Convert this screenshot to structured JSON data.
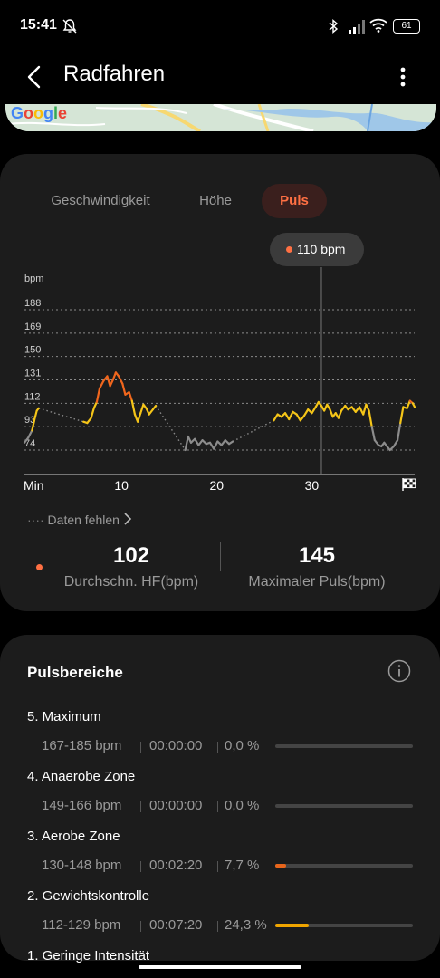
{
  "status_bar": {
    "time": "15:41",
    "battery": "61"
  },
  "header": {
    "title": "Radfahren"
  },
  "map": {
    "logo": "Google"
  },
  "tabs": [
    {
      "label": "Geschwindigkeit",
      "active": false
    },
    {
      "label": "Höhe",
      "active": false
    },
    {
      "label": "Puls",
      "active": true
    }
  ],
  "tooltip": {
    "text": "110 bpm"
  },
  "chart_data": {
    "type": "line",
    "ylabel": "bpm",
    "y_ticks": [
      188,
      169,
      150,
      131,
      112,
      93,
      74
    ],
    "x_ticks": [
      "Min",
      "10",
      "20",
      "30"
    ],
    "xlim": [
      0,
      41
    ],
    "selected_x": 31.2,
    "series": [
      {
        "segments": [
          [
            [
              0,
              80
            ],
            [
              0.4,
              84
            ],
            [
              0.8,
              90
            ],
            [
              1.1,
              100
            ],
            [
              1.3,
              106
            ],
            [
              1.5,
              108
            ]
          ],
          [
            [
              6.2,
              97
            ],
            [
              6.6,
              96
            ],
            [
              7.0,
              100
            ],
            [
              7.3,
              108
            ],
            [
              7.6,
              113
            ],
            [
              7.9,
              124
            ],
            [
              8.3,
              130
            ],
            [
              8.7,
              134
            ],
            [
              9.0,
              126
            ],
            [
              9.3,
              131
            ],
            [
              9.6,
              137
            ],
            [
              9.9,
              134
            ],
            [
              10.3,
              128
            ],
            [
              10.6,
              119
            ],
            [
              11.0,
              121
            ],
            [
              11.3,
              114
            ],
            [
              11.6,
              103
            ],
            [
              11.9,
              97
            ],
            [
              12.2,
              104
            ],
            [
              12.5,
              111
            ],
            [
              12.8,
              108
            ],
            [
              13.1,
              103
            ],
            [
              13.5,
              107
            ],
            [
              13.8,
              110
            ]
          ],
          [
            [
              16.9,
              74
            ],
            [
              17.2,
              85
            ],
            [
              17.5,
              80
            ],
            [
              17.9,
              83
            ],
            [
              18.3,
              78
            ],
            [
              18.7,
              82
            ],
            [
              19.1,
              79
            ],
            [
              19.5,
              80
            ],
            [
              19.9,
              75
            ],
            [
              20.3,
              81
            ],
            [
              20.7,
              78
            ],
            [
              21.1,
              82
            ],
            [
              21.5,
              79
            ],
            [
              21.9,
              81
            ]
          ],
          [
            [
              26.2,
              98
            ],
            [
              26.6,
              103
            ],
            [
              27.0,
              101
            ],
            [
              27.4,
              104
            ],
            [
              27.8,
              99
            ],
            [
              28.2,
              105
            ],
            [
              28.6,
              103
            ],
            [
              29.0,
              98
            ],
            [
              29.4,
              102
            ],
            [
              29.8,
              107
            ],
            [
              30.2,
              104
            ],
            [
              30.6,
              109
            ],
            [
              30.9,
              113
            ],
            [
              31.2,
              110
            ],
            [
              31.5,
              106
            ],
            [
              31.8,
              111
            ],
            [
              32.1,
              107
            ],
            [
              32.4,
              101
            ],
            [
              32.7,
              104
            ],
            [
              33.0,
              100
            ],
            [
              33.3,
              106
            ],
            [
              33.7,
              110
            ],
            [
              34.0,
              107
            ],
            [
              34.4,
              109
            ],
            [
              34.8,
              105
            ],
            [
              35.2,
              109
            ],
            [
              35.6,
              103
            ],
            [
              35.9,
              111
            ],
            [
              36.2,
              106
            ],
            [
              36.5,
              93
            ],
            [
              36.8,
              82
            ],
            [
              37.2,
              78
            ],
            [
              37.5,
              77
            ],
            [
              37.8,
              80
            ],
            [
              38.1,
              77
            ],
            [
              38.4,
              74
            ],
            [
              38.8,
              77
            ],
            [
              39.2,
              82
            ],
            [
              39.5,
              96
            ],
            [
              39.8,
              109
            ],
            [
              40.2,
              108
            ],
            [
              40.5,
              114
            ],
            [
              40.8,
              112
            ],
            [
              41.0,
              109
            ]
          ]
        ]
      }
    ]
  },
  "missing_data": {
    "label": "Daten fehlen"
  },
  "stats": {
    "avg": {
      "value": "102",
      "label": "Durchschn. HF(bpm)"
    },
    "max": {
      "value": "145",
      "label": "Maximaler Puls(bpm)"
    }
  },
  "zones": {
    "title": "Pulsbereiche",
    "items": [
      {
        "name": "5. Maximum",
        "range": "167-185 bpm",
        "time": "00:00:00",
        "percent": "0,0 %",
        "fraction": 0.0,
        "color": "#e8651b"
      },
      {
        "name": "4. Anaerobe Zone",
        "range": "149-166 bpm",
        "time": "00:00:00",
        "percent": "0,0 %",
        "fraction": 0.0,
        "color": "#e8651b"
      },
      {
        "name": "3. Aerobe Zone",
        "range": "130-148 bpm",
        "time": "00:02:20",
        "percent": "7,7 %",
        "fraction": 0.077,
        "color": "#e8651b"
      },
      {
        "name": "2. Gewichtskontrolle",
        "range": "112-129 bpm",
        "time": "00:07:20",
        "percent": "24,3 %",
        "fraction": 0.243,
        "color": "#f0a500"
      },
      {
        "name": "1. Geringe Intensität",
        "range": "",
        "time": "",
        "percent": "",
        "fraction": 0.0,
        "color": "#f5c518"
      }
    ]
  },
  "colors": {
    "accent": "#ff7043",
    "high": "#f0661d",
    "mid": "#f5c518",
    "low": "#8c8c8c",
    "card": "#1c1c1c"
  }
}
